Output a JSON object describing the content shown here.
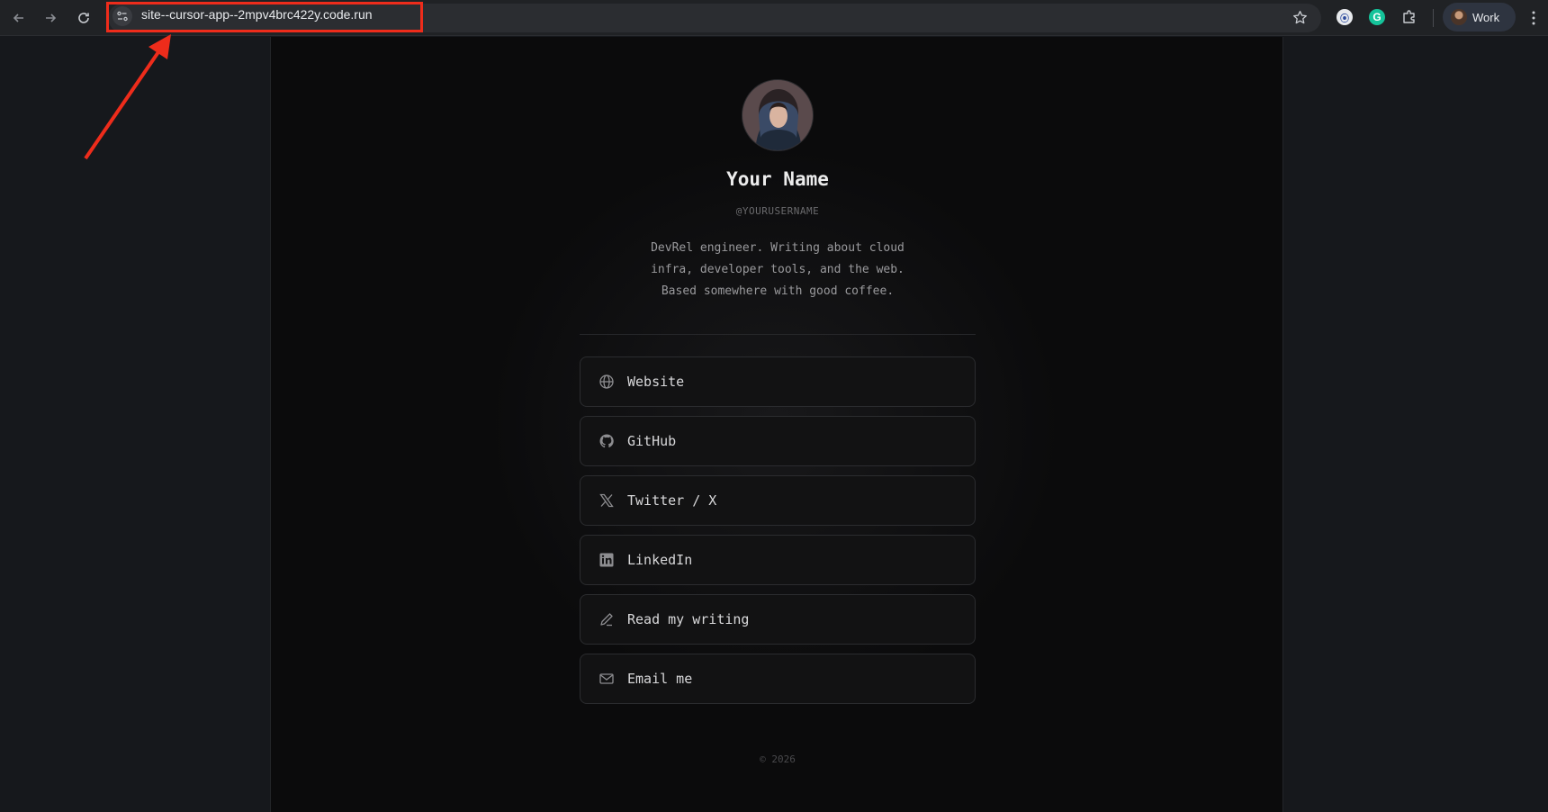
{
  "browser": {
    "url": "site--cursor-app--2mpv4brc422y.code.run",
    "profile_label": "Work",
    "ext_grammarly_letter": "G",
    "icons": [
      "back-arrow-icon",
      "forward-arrow-icon",
      "reload-icon",
      "site-info-icon",
      "bookmark-star-icon",
      "extension-puzzle-icon",
      "kebab-menu-icon"
    ]
  },
  "profile": {
    "name": "Your Name",
    "handle": "@YOURUSERNAME",
    "bio_lines": [
      "DevRel engineer. Writing about cloud",
      "infra, developer tools, and the web.",
      "Based somewhere with good coffee."
    ]
  },
  "links": [
    {
      "label": "Website",
      "icon": "globe-icon"
    },
    {
      "label": "GitHub",
      "icon": "github-icon"
    },
    {
      "label": "Twitter / X",
      "icon": "x-logo-icon"
    },
    {
      "label": "LinkedIn",
      "icon": "linkedin-icon"
    },
    {
      "label": "Read my writing",
      "icon": "pencil-icon"
    },
    {
      "label": "Email me",
      "icon": "mail-icon"
    }
  ],
  "footer": "© 2026",
  "colors": {
    "annotation": "#ee2c1b",
    "page_bg": "#0b0b0c",
    "text_primary": "#ececec"
  }
}
